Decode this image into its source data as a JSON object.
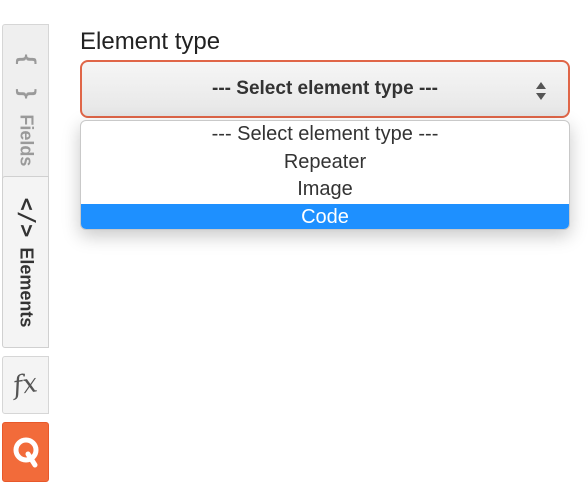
{
  "sidebar": {
    "tabs": [
      {
        "label": "Fields",
        "icon": "braces-icon",
        "glyph": "{ }",
        "state": "inactive"
      },
      {
        "label": "Elements",
        "icon": "code-icon",
        "glyph": "</>",
        "state": "active"
      },
      {
        "icon": "function-icon",
        "glyph": "fx"
      },
      {
        "icon": "brand-logo",
        "color": "#f26b3a"
      }
    ]
  },
  "form": {
    "element_type": {
      "label": "Element type",
      "selected": "--- Select element type ---",
      "options": [
        "--- Select element type ---",
        "Repeater",
        "Image",
        "Code"
      ],
      "highlighted_option": "Code",
      "border_color": "#e06648",
      "highlight_color": "#1e90ff"
    }
  }
}
